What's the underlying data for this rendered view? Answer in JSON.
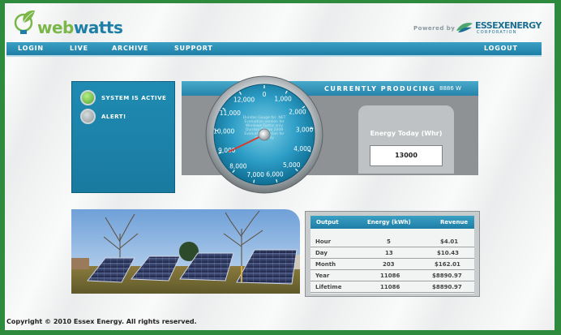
{
  "brand": {
    "logo_text_1": "web",
    "logo_text_2": "watts",
    "powered_by": "Powered by",
    "partner_name": "ESSEXENERGY",
    "partner_sub": "CORPORATION"
  },
  "nav": {
    "login": "LOGIN",
    "live": "LIVE",
    "archive": "ARCHIVE",
    "support": "SUPPORT",
    "logout": "LOGOUT"
  },
  "status": {
    "active": "SYSTEM IS ACTIVE",
    "alert": "ALERT!"
  },
  "producing": {
    "title": "CURRENTLY PRODUCING",
    "watts": "8886 W"
  },
  "gauge": {
    "ticks": [
      "0",
      "1,000",
      "2,000",
      "3,000",
      "4,000",
      "5,000",
      "6,000",
      "7,000",
      "8,000",
      "9,000",
      "10,000",
      "11,000",
      "12,000"
    ],
    "value": 8886,
    "max": 12000,
    "watermark": "Dundas Gauge for .NET Evaluation version for Windows Forms only Dundas Gauge 2008 Evaluation version for demo only"
  },
  "energy_today": {
    "title": "Energy Today (Whr)",
    "value": "13000"
  },
  "table": {
    "headers": [
      "Output",
      "Energy (kWh)",
      "Revenue"
    ],
    "rows": [
      [
        "Hour",
        "5",
        "$4.01"
      ],
      [
        "Day",
        "13",
        "$10.43"
      ],
      [
        "Month",
        "203",
        "$162.01"
      ],
      [
        "Year",
        "11086",
        "$8890.97"
      ],
      [
        "Lifetime",
        "11086",
        "$8890.97"
      ]
    ]
  },
  "footer": "Copyright © 2010 Essex Energy. All rights reserved.",
  "colors": {
    "frame_green": "#2e8b3e",
    "nav_blue": "#1e7ea5",
    "logo_green": "#7ab648",
    "logo_blue": "#1d7fa8",
    "needle_red": "#d63a2a"
  }
}
